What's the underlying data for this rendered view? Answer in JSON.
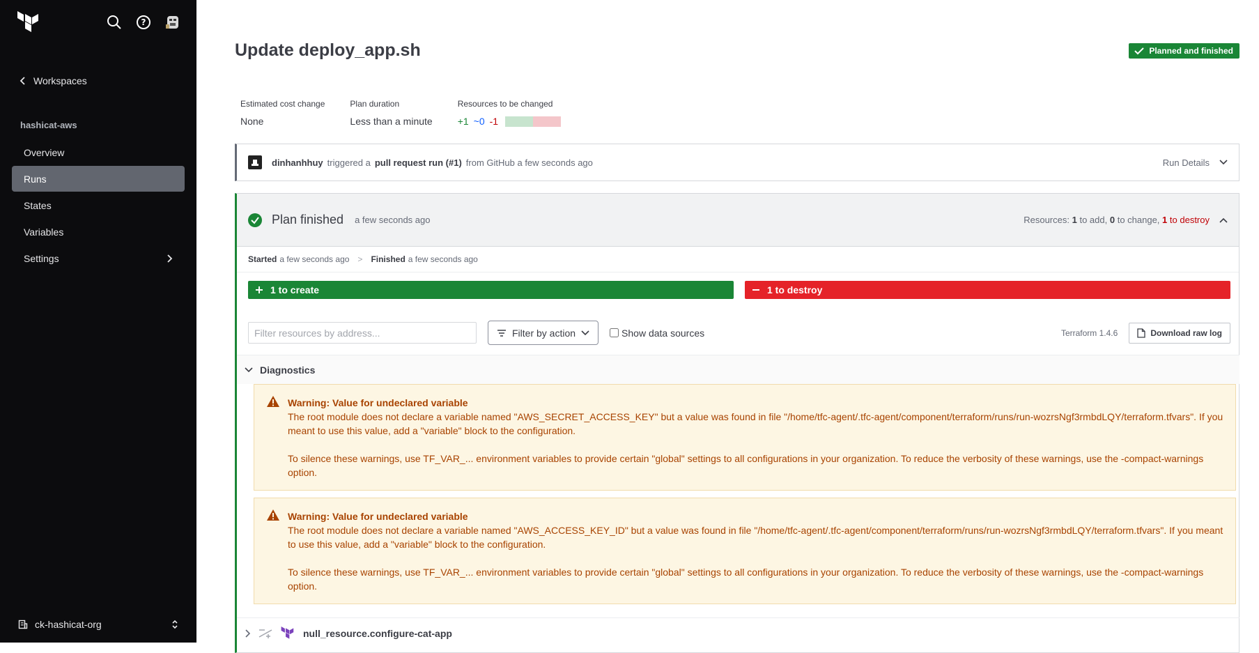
{
  "sidebar": {
    "back_label": "Workspaces",
    "workspace_name": "hashicat-aws",
    "items": [
      {
        "label": "Overview"
      },
      {
        "label": "Runs"
      },
      {
        "label": "States"
      },
      {
        "label": "Variables"
      },
      {
        "label": "Settings"
      }
    ],
    "org_name": "ck-hashicat-org"
  },
  "header": {
    "title": "Update deploy_app.sh",
    "status_badge": "Planned and finished"
  },
  "metrics": {
    "cost_label": "Estimated cost change",
    "cost_value": "None",
    "duration_label": "Plan duration",
    "duration_value": "Less than a minute",
    "resources_label": "Resources to be changed",
    "add": "+1",
    "change": "~0",
    "destroy": "-1"
  },
  "trigger": {
    "user": "dinhanhhuy",
    "text1": "triggered a",
    "run_type": "pull request run (#1)",
    "text2": "from GitHub a few seconds ago",
    "details_label": "Run Details"
  },
  "plan": {
    "title": "Plan finished",
    "time": "a few seconds ago",
    "res_prefix": "Resources:",
    "res_add": "1",
    "res_add_text": "to add,",
    "res_change": "0",
    "res_change_text": "to change,",
    "res_destroy": "1",
    "res_destroy_text": "to destroy",
    "started_label": "Started",
    "started_time": "a few seconds ago",
    "finished_label": "Finished",
    "finished_time": "a few seconds ago",
    "create_bar": "1 to create",
    "destroy_bar": "1 to destroy",
    "filter_placeholder": "Filter resources by address...",
    "filter_action_label": "Filter by action",
    "show_data_sources": "Show data sources",
    "terraform_version": "Terraform 1.4.6",
    "download_label": "Download raw log",
    "diagnostics_label": "Diagnostics",
    "warnings": [
      {
        "title": "Warning: Value for undeclared variable",
        "body": "The root module does not declare a variable named \"AWS_SECRET_ACCESS_KEY\" but a value was found in file \"/home/tfc-agent/.tfc-agent/component/terraform/runs/run-wozrsNgf3rmbdLQY/terraform.tfvars\". If you meant to use this value, add a \"variable\" block to the configuration.",
        "body2": "To silence these warnings, use TF_VAR_... environment variables to provide certain \"global\" settings to all configurations in your organization. To reduce the verbosity of these warnings, use the -compact-warnings option."
      },
      {
        "title": "Warning: Value for undeclared variable",
        "body": "The root module does not declare a variable named \"AWS_ACCESS_KEY_ID\" but a value was found in file \"/home/tfc-agent/.tfc-agent/component/terraform/runs/run-wozrsNgf3rmbdLQY/terraform.tfvars\". If you meant to use this value, add a \"variable\" block to the configuration.",
        "body2": "To silence these warnings, use TF_VAR_... environment variables to provide certain \"global\" settings to all configurations in your organization. To reduce the verbosity of these warnings, use the -compact-warnings option."
      }
    ],
    "resource_name": "null_resource.configure-cat-app"
  },
  "colors": {
    "accent_green": "#1a8636",
    "destroy_red": "#e52228",
    "warning_text": "#a84301",
    "sidebar_bg": "#0c0c0e"
  },
  "icons": [
    "terraform-logo",
    "search-icon",
    "help-icon",
    "avatar",
    "chevron-left-icon",
    "chevron-right-icon",
    "building-icon",
    "chevron-updown-icon",
    "check-icon",
    "check-circle-icon",
    "chevron-down-icon",
    "chevron-up-icon",
    "plus-icon",
    "minus-icon",
    "filter-icon",
    "file-icon",
    "warning-icon",
    "replace-icon"
  ]
}
